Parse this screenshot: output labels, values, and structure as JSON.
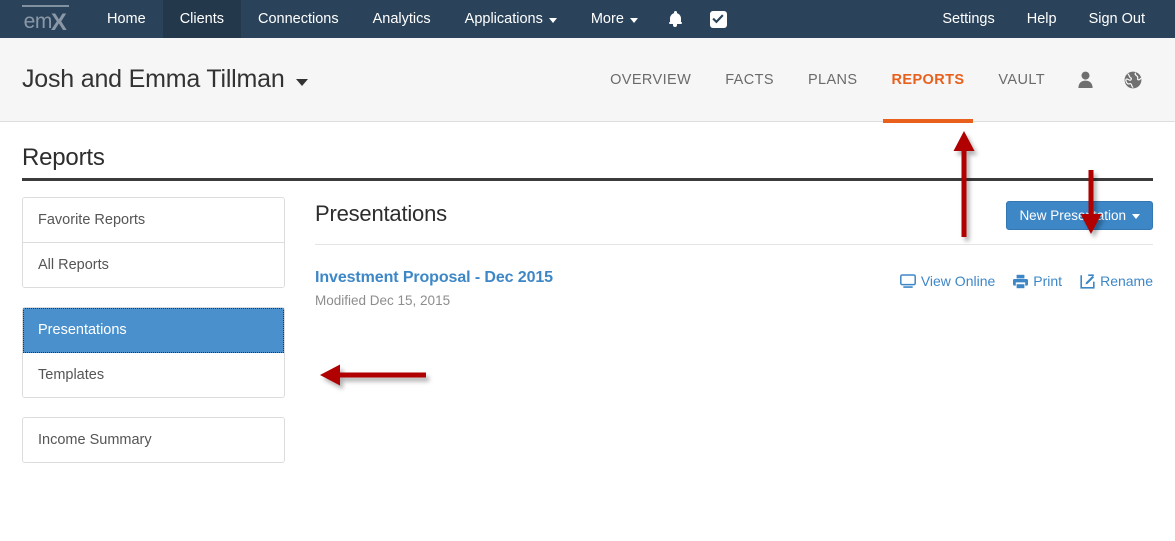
{
  "navbar": {
    "logo_text_1": "em",
    "logo_text_2": "X",
    "left_items": [
      {
        "label": "Home",
        "active": false,
        "caret": false
      },
      {
        "label": "Clients",
        "active": true,
        "caret": false
      },
      {
        "label": "Connections",
        "active": false,
        "caret": false
      },
      {
        "label": "Analytics",
        "active": false,
        "caret": false
      },
      {
        "label": "Applications",
        "active": false,
        "caret": true
      },
      {
        "label": "More",
        "active": false,
        "caret": true
      }
    ],
    "icons": [
      {
        "name": "bell-icon"
      },
      {
        "name": "checkbox-icon"
      }
    ],
    "right_items": [
      {
        "label": "Settings"
      },
      {
        "label": "Help"
      },
      {
        "label": "Sign Out"
      }
    ],
    "background_color": "#2b435a",
    "active_background_color": "#24384b"
  },
  "client_header": {
    "client_name": "Josh and Emma Tillman",
    "subnav": [
      {
        "label": "OVERVIEW",
        "active": false
      },
      {
        "label": "FACTS",
        "active": false
      },
      {
        "label": "PLANS",
        "active": false
      },
      {
        "label": "REPORTS",
        "active": true
      },
      {
        "label": "VAULT",
        "active": false
      }
    ],
    "icons": [
      {
        "name": "person-icon"
      },
      {
        "name": "globe-icon"
      }
    ],
    "accent_color": "#e8601c"
  },
  "page": {
    "title": "Reports"
  },
  "sidebar": {
    "groups": [
      {
        "items": [
          {
            "label": "Favorite Reports",
            "selected": false
          },
          {
            "label": "All Reports",
            "selected": false
          }
        ]
      },
      {
        "items": [
          {
            "label": "Presentations",
            "selected": true
          },
          {
            "label": "Templates",
            "selected": false
          }
        ]
      },
      {
        "items": [
          {
            "label": "Income Summary",
            "selected": false
          }
        ]
      }
    ],
    "selected_color": "#4a90cc"
  },
  "main": {
    "title": "Presentations",
    "new_button_label": "New Presentation",
    "new_button_color": "#3d87c7",
    "reports": [
      {
        "name": "Investment Proposal - Dec 2015",
        "modified": "Modified Dec 15, 2015",
        "actions": [
          {
            "label": "View Online",
            "icon": "monitor-icon"
          },
          {
            "label": "Print",
            "icon": "printer-icon"
          },
          {
            "label": "Rename",
            "icon": "edit-pencil-icon"
          }
        ]
      }
    ]
  },
  "annotations": {
    "color": "#b00000",
    "arrows": [
      {
        "name": "arrow-pointing-to-reports-tab",
        "direction": "up"
      },
      {
        "name": "arrow-pointing-to-new-presentation-button",
        "direction": "down"
      },
      {
        "name": "arrow-pointing-to-presentations-sidebar-item",
        "direction": "left"
      }
    ]
  }
}
